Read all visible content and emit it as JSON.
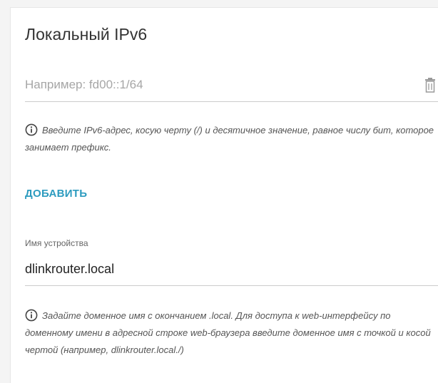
{
  "section": {
    "title": "Локальный IPv6"
  },
  "ipv6_field": {
    "placeholder": "Например: fd00::1/64",
    "value": "",
    "delete_icon": "trash-icon"
  },
  "ipv6_hint": {
    "icon": "info-icon",
    "text": "Введите IPv6-адрес, косую черту (/) и десятичное значение, равное числу бит, которое занимает префикс."
  },
  "add_button": {
    "label": "ДОБАВИТЬ"
  },
  "device_name_field": {
    "label": "Имя устройства",
    "value": "dlinkrouter.local"
  },
  "device_name_hint": {
    "icon": "info-icon",
    "text": "Задайте доменное имя с окончанием .local. Для доступа к web-интерфейсу по доменному имени в адресной строке web-браузера введите доменное имя с точкой и косой чертой (например, dlinkrouter.local./)"
  },
  "colors": {
    "accent": "#2c9bbf",
    "text": "#333333",
    "placeholder": "#a6a6a6",
    "divider": "#cccccc"
  }
}
